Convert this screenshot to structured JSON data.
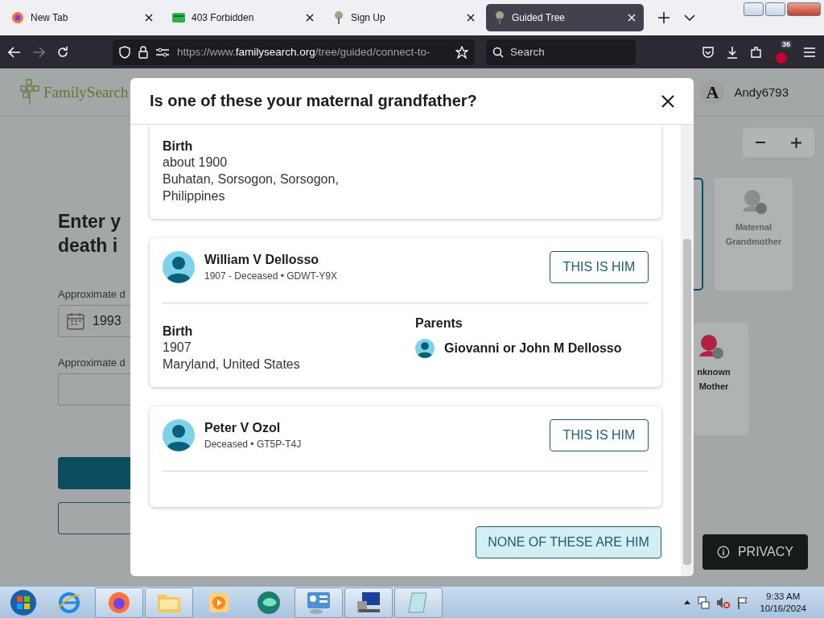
{
  "browser": {
    "tabs": [
      {
        "title": "New Tab",
        "selected": false,
        "kind": "firefox"
      },
      {
        "title": "403 Forbidden",
        "selected": false,
        "kind": "card"
      },
      {
        "title": "Sign Up",
        "selected": false,
        "kind": "tree"
      },
      {
        "title": "Guided Tree",
        "selected": true,
        "kind": "tree"
      }
    ],
    "url": {
      "scheme": "https://www.",
      "domain": "familysearch.org",
      "path": "/tree/guided/connect-to-"
    },
    "search": {
      "placeholder": "Search"
    },
    "extension_badge": "36"
  },
  "page": {
    "logo": "FamilySearch",
    "user": {
      "initial": "A",
      "name": "Andy6793"
    },
    "heading": [
      "Enter y",
      "death i"
    ],
    "fields": [
      {
        "label": "Approximate d",
        "value": "1993"
      },
      {
        "label": "Approximate d"
      }
    ],
    "tree_cards": [
      {
        "label": "Maternal Grandmother",
        "color": "#8c8f8f"
      },
      {
        "label": "nknown Mother",
        "color": "#b0223f"
      }
    ],
    "privacy_button": "PRIVACY"
  },
  "modal": {
    "title": "Is one of these your maternal grandfather?",
    "partial_record": {
      "birth": {
        "label": "Birth",
        "lines": [
          "about 1900",
          "Buhatan, Sorsogon, Sorsogon,",
          "Philippines"
        ]
      }
    },
    "records": [
      {
        "name": "William V Dellosso",
        "details": "1907 - Deceased • GDWT-Y9X",
        "button": "THIS IS HIM",
        "birth": {
          "label": "Birth",
          "lines": [
            "1907",
            "Maryland, United States"
          ]
        },
        "parents": {
          "label": "Parents",
          "names": [
            "Giovanni or John M Dellosso"
          ]
        }
      },
      {
        "name": "Peter V Ozol",
        "details": "Deceased • GT5P-T4J",
        "button": "THIS IS HIM"
      }
    ],
    "none_button": "NONE OF THESE ARE HIM"
  },
  "taskbar": {
    "time": "9:33 AM",
    "date": "10/16/2024"
  }
}
